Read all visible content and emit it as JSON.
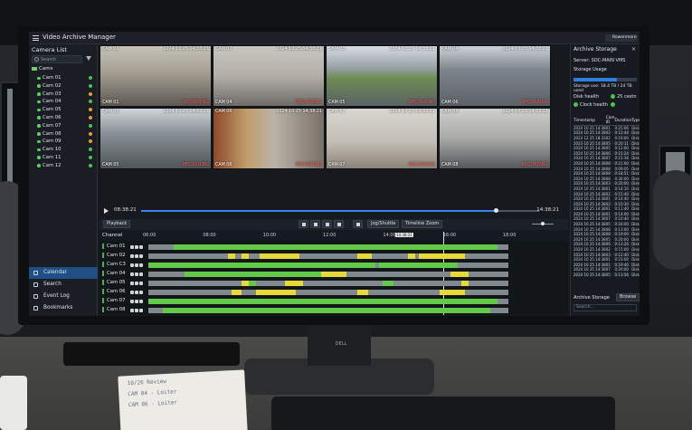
{
  "app": {
    "title": "Video Archive Manager"
  },
  "sidebar": {
    "title": "Camera List",
    "search_placeholder": "Search",
    "root_label": "Cams",
    "cameras": [
      {
        "label": "Cam 01",
        "status": "ok"
      },
      {
        "label": "Cam 02",
        "status": "ok"
      },
      {
        "label": "Cam 03",
        "status": "warn"
      },
      {
        "label": "Cam 04",
        "status": "ok"
      },
      {
        "label": "Cam 05",
        "status": "warn"
      },
      {
        "label": "Cam 06",
        "status": "warn"
      },
      {
        "label": "Cam 07",
        "status": "ok"
      },
      {
        "label": "Cam 08",
        "status": "warn"
      },
      {
        "label": "Cam 09",
        "status": "warn"
      },
      {
        "label": "Cam 10",
        "status": "ok"
      },
      {
        "label": "Cam 11",
        "status": "ok"
      },
      {
        "label": "Cam 12",
        "status": "ok"
      }
    ],
    "nav": [
      {
        "label": "Calendar",
        "active": true
      },
      {
        "label": "Search",
        "active": false
      },
      {
        "label": "Event Log",
        "active": false
      },
      {
        "label": "Bookmarks",
        "active": false
      }
    ]
  },
  "tiles": [
    {
      "tl": "CAM 01",
      "tr": "2024 10 25 14:38:21",
      "bl": "CAM 01",
      "br": "RECORDING",
      "scene": "lobby"
    },
    {
      "tl": "CAM 02",
      "tr": "2024 10 25 14:38:21",
      "bl": "CAM 04",
      "br": "RECORDING",
      "scene": "hall"
    },
    {
      "tl": "CAM 03",
      "tr": "2024 10 25 14:38:21",
      "bl": "CAM 05",
      "br": "RECORDING",
      "scene": "lot"
    },
    {
      "tl": "CAM 04",
      "tr": "2024 10 25 14:38:21",
      "bl": "CAM 06",
      "br": "RECORDING",
      "scene": "lot2"
    },
    {
      "tl": "CAM 05",
      "tr": "2024 10 25 14:38:21",
      "bl": "CAM 05",
      "br": "RECORDING",
      "scene": "lot3"
    },
    {
      "tl": "CAM 06",
      "tr": "2024 10 25 14:38:21",
      "bl": "CAM 06",
      "br": "RECORDING",
      "scene": "warehouse"
    },
    {
      "tl": "CAM 57",
      "tr": "2024 10 25 14:38:21",
      "bl": "CAM 07",
      "br": "RECORDING",
      "scene": "room"
    },
    {
      "tl": "CAM 08",
      "tr": "2024 10 25 14:38:21",
      "bl": "CAM 08",
      "br": "RECORDING",
      "scene": "entrance"
    }
  ],
  "playback": {
    "start": "08:38:21",
    "end": "14:38:21",
    "progress": 0.89
  },
  "toolbar": {
    "playback_label": "Playback",
    "jog_label": "Jog/Shuttle",
    "timeline_zoom_label": "Timeline Zoom"
  },
  "timeline": {
    "header": "Channel",
    "ticks": [
      "06:00",
      "08:00",
      "10:00",
      "12:00",
      "14:00",
      "16:00",
      "18:00"
    ],
    "playhead_label": "14:38:21",
    "playhead_fraction": 0.82,
    "colors": {
      "motion": "#63c94a",
      "event": "#e8d93a",
      "gap": "#808890"
    },
    "channels": [
      {
        "label": "Cam 01",
        "segments": [
          {
            "s": 0.07,
            "e": 0.97,
            "k": "motion"
          }
        ]
      },
      {
        "label": "Cam 02",
        "segments": [
          {
            "s": 0.22,
            "e": 0.24,
            "k": "event"
          },
          {
            "s": 0.26,
            "e": 0.28,
            "k": "event"
          },
          {
            "s": 0.31,
            "e": 0.42,
            "k": "event"
          },
          {
            "s": 0.58,
            "e": 0.62,
            "k": "event"
          },
          {
            "s": 0.72,
            "e": 0.74,
            "k": "event"
          },
          {
            "s": 0.75,
            "e": 0.88,
            "k": "event"
          }
        ]
      },
      {
        "label": "Cam C3",
        "segments": [
          {
            "s": 0.0,
            "e": 0.3,
            "k": "motion"
          },
          {
            "s": 0.3,
            "e": 0.63,
            "k": "motion"
          },
          {
            "s": 0.64,
            "e": 0.86,
            "k": "motion"
          }
        ]
      },
      {
        "label": "Cam 04",
        "segments": [
          {
            "s": 0.1,
            "e": 0.5,
            "k": "motion"
          },
          {
            "s": 0.48,
            "e": 0.55,
            "k": "event"
          },
          {
            "s": 0.84,
            "e": 0.89,
            "k": "event"
          }
        ]
      },
      {
        "label": "Cam 05",
        "segments": [
          {
            "s": 0.26,
            "e": 0.28,
            "k": "event"
          },
          {
            "s": 0.28,
            "e": 0.3,
            "k": "motion"
          },
          {
            "s": 0.38,
            "e": 0.43,
            "k": "event"
          },
          {
            "s": 0.65,
            "e": 0.68,
            "k": "motion"
          },
          {
            "s": 0.87,
            "e": 0.89,
            "k": "event"
          }
        ]
      },
      {
        "label": "Cam 06",
        "segments": [
          {
            "s": 0.23,
            "e": 0.26,
            "k": "event"
          },
          {
            "s": 0.3,
            "e": 0.41,
            "k": "event"
          },
          {
            "s": 0.58,
            "e": 0.61,
            "k": "event"
          },
          {
            "s": 0.81,
            "e": 0.88,
            "k": "event"
          }
        ]
      },
      {
        "label": "Cam 07",
        "segments": [
          {
            "s": 0.0,
            "e": 0.97,
            "k": "motion"
          }
        ]
      },
      {
        "label": "Cam 08",
        "segments": [
          {
            "s": 0.04,
            "e": 0.95,
            "k": "motion"
          }
        ]
      }
    ]
  },
  "storage": {
    "title": "Archive Storage",
    "user": "Rowenmore",
    "server": "Server: SOC-MAIN VMS",
    "usage_label": "Storage Usage",
    "usage_fraction": 0.68,
    "usage_text": "Storage use: 18.4 TB / 24 TB used",
    "disk_health": "Disk health",
    "clock_health": "Clock health",
    "disk_status": "25 cestn",
    "columns": [
      "Timestamp",
      "Cam ID",
      "Duration",
      "Type"
    ],
    "rows": [
      [
        "2024 10 25 14:38",
        "01",
        "0:25:06",
        "Disk"
      ],
      [
        "2024 10 25 14:38",
        "02",
        "0:12:44",
        "Disk"
      ],
      [
        "2023 12 25 18:33",
        "02",
        "0:19:00",
        "Disk"
      ],
      [
        "2023 10 25 14:38",
        "05",
        "0:20:11",
        "Disk"
      ],
      [
        "2024 10 25 14:38",
        "05",
        "0:12:00",
        "Disk"
      ],
      [
        "2024 10 25 14:38",
        "06",
        "0:15:24",
        "Disk"
      ],
      [
        "2024 10 25 14:38",
        "07",
        "0:15:38",
        "Disk"
      ],
      [
        "2024 10 25 14:38",
        "08",
        "0:21:00",
        "Disk"
      ],
      [
        "2024 10 25 14:38",
        "08",
        "0:09:05",
        "Disk"
      ],
      [
        "2024 10 25 14:38",
        "08",
        "0:18:51",
        "Disk"
      ],
      [
        "2024 10 25 14:38",
        "08",
        "0:30:00",
        "Disk"
      ],
      [
        "2024 10 25 14:38",
        "03",
        "0:20:00",
        "Disk"
      ],
      [
        "2024 10 25 14:38",
        "01",
        "0:14:10",
        "Disk"
      ],
      [
        "2024 10 25 14:38",
        "02",
        "0:15:40",
        "Disk"
      ],
      [
        "2024 10 25 14:38",
        "01",
        "0:14:40",
        "Disk"
      ],
      [
        "2024 10 25 14:38",
        "02",
        "0:10:30",
        "Disk"
      ],
      [
        "2024 10 25 14:38",
        "01",
        "0:11:40",
        "Disk"
      ],
      [
        "2024 10 25 14:38",
        "01",
        "0:14:00",
        "Disk"
      ],
      [
        "2024 10 25 14:38",
        "07",
        "0:10:40",
        "Disk"
      ],
      [
        "2024 10 25 14:38",
        "05",
        "0:16:00",
        "Disk"
      ],
      [
        "2024 10 25 14:38",
        "08",
        "0:13:00",
        "Disk"
      ],
      [
        "2024 10 25 14:38",
        "08",
        "0:19:00",
        "Disk"
      ],
      [
        "2024 10 25 14:38",
        "05",
        "0:20:00",
        "Disk"
      ],
      [
        "2024 10 25 14:38",
        "06",
        "0:13:26",
        "Disk"
      ],
      [
        "2024 10 25 14:38",
        "02",
        "0:15:00",
        "Disk"
      ],
      [
        "2024 10 25 14:38",
        "03",
        "0:12:40",
        "Disk"
      ],
      [
        "2024 10 25 14:38",
        "01",
        "0:23:00",
        "Disk"
      ],
      [
        "2024 10 25 14:38",
        "01",
        "0:19:40",
        "Disk"
      ],
      [
        "2024 10 25 14:38",
        "07",
        "0:20:00",
        "Disk"
      ],
      [
        "2024 10 25 14:38",
        "05",
        "0:13:56",
        "Disk"
      ]
    ],
    "footer_label": "Archive Storage",
    "footer_button": "Browse",
    "footer_search": "Search..."
  },
  "note": {
    "lines": [
      "10/26 Review",
      "CAM 04 - Loiter",
      "CAM 06 - Loiter"
    ]
  },
  "monitor_brand": "DELL"
}
